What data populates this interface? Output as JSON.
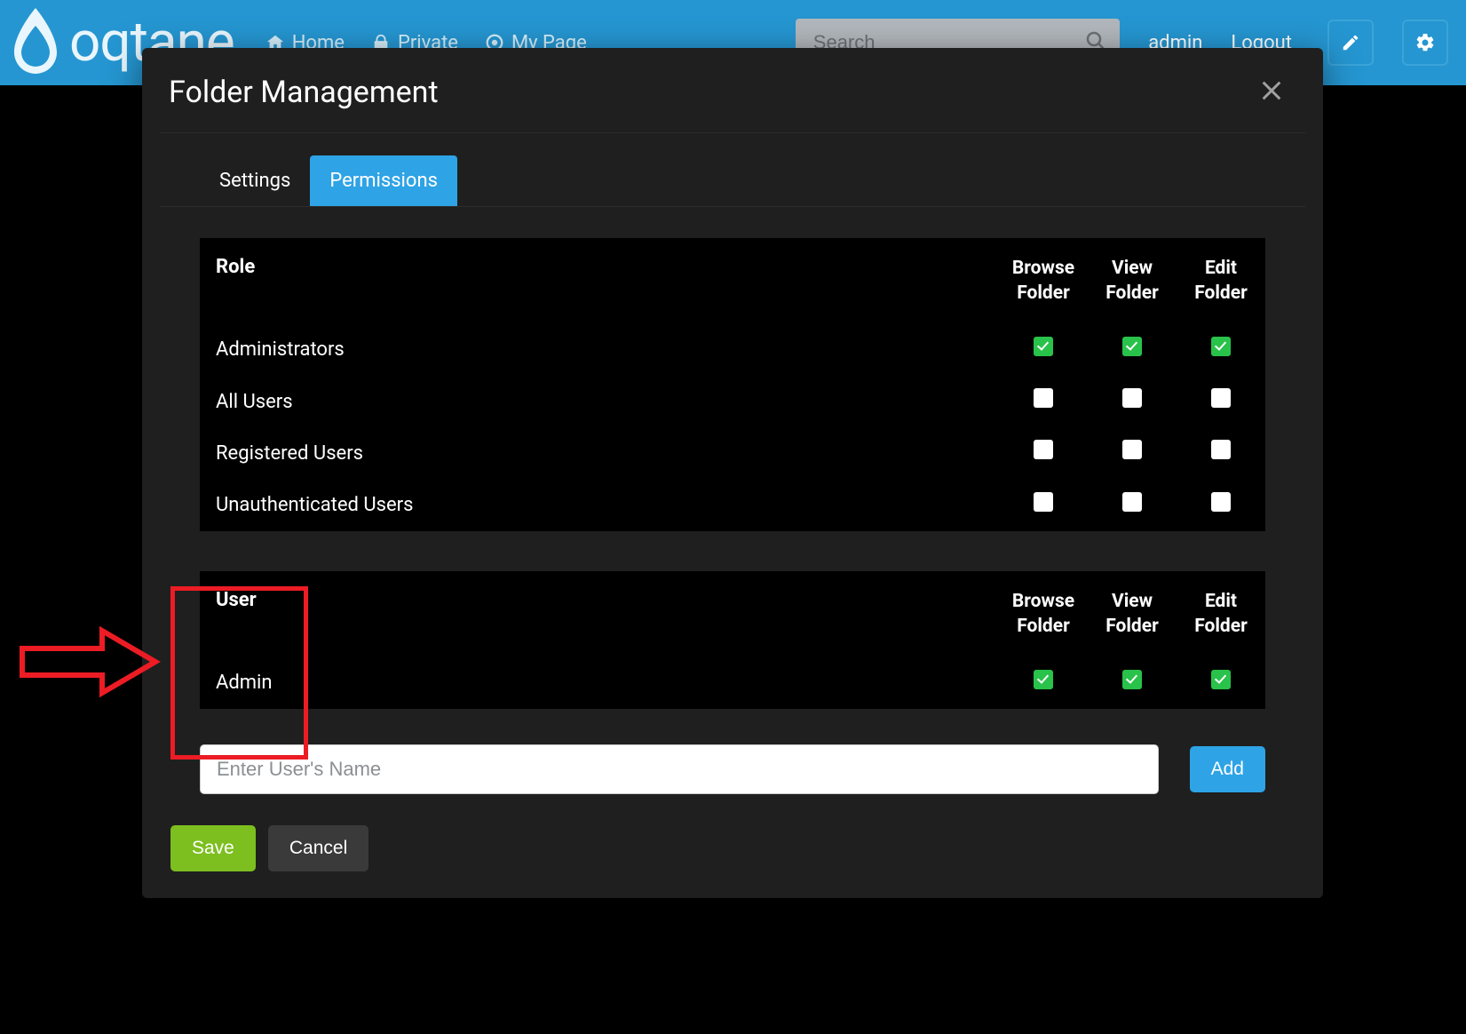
{
  "brand_text": "oqtane",
  "nav": {
    "home": "Home",
    "private": "Private",
    "mypage": "My Page"
  },
  "search": {
    "placeholder": "Search"
  },
  "topbar": {
    "user": "admin",
    "logout": "Logout"
  },
  "modal": {
    "title": "Folder Management",
    "tabs": {
      "settings": "Settings",
      "permissions": "Permissions"
    },
    "columns": {
      "role": "Role",
      "user": "User",
      "browse": "Browse Folder",
      "view": "View Folder",
      "edit": "Edit Folder"
    },
    "roles": [
      {
        "name": "Administrators",
        "browse": true,
        "view": true,
        "edit": true
      },
      {
        "name": "All Users",
        "browse": false,
        "view": false,
        "edit": false
      },
      {
        "name": "Registered Users",
        "browse": false,
        "view": false,
        "edit": false
      },
      {
        "name": "Unauthenticated Users",
        "browse": false,
        "view": false,
        "edit": false
      }
    ],
    "users": [
      {
        "name": "Admin",
        "browse": true,
        "view": true,
        "edit": true
      }
    ],
    "user_input_placeholder": "Enter User's Name",
    "buttons": {
      "add": "Add",
      "save": "Save",
      "cancel": "Cancel"
    }
  }
}
